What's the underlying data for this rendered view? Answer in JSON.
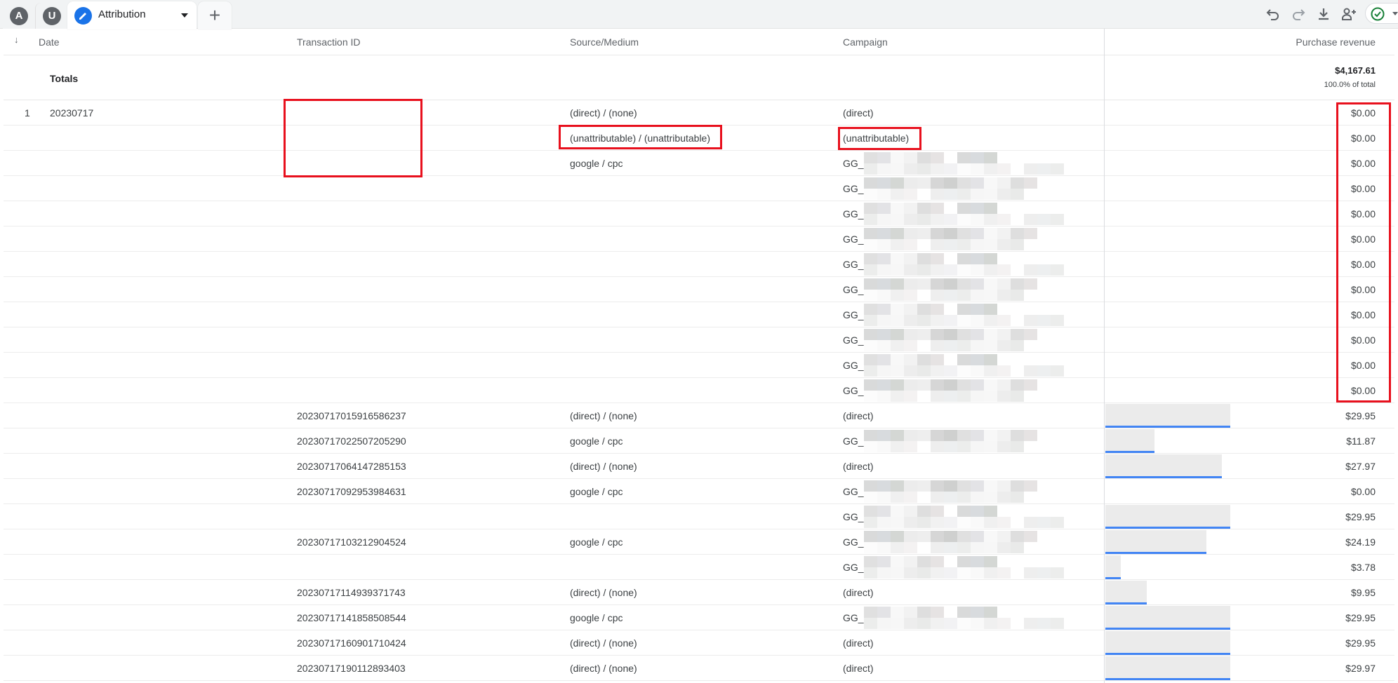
{
  "tabs": {
    "segments": [
      {
        "initial": "A"
      },
      {
        "initial": "U"
      }
    ],
    "active": {
      "label": "Attribution",
      "icon": "pencil-icon"
    },
    "add_label": "+"
  },
  "toolbar": {
    "icons": [
      "undo-icon",
      "redo-icon",
      "download-icon",
      "share-users-icon",
      "status-check-icon"
    ]
  },
  "table": {
    "sort_indicator": "↓",
    "columns": [
      "Date",
      "Transaction ID",
      "Source/Medium",
      "Campaign",
      "Purchase revenue"
    ],
    "totals": {
      "label": "Totals",
      "value": "$4,167.61",
      "percent": "100.0% of total"
    },
    "rows": [
      {
        "num": "1",
        "date": "20230717",
        "tx": "",
        "src": "(direct) / (none)",
        "camp": "(direct)",
        "rev": "$0.00",
        "bar": 0
      },
      {
        "num": "",
        "date": "",
        "tx": "",
        "src": "(unattributable) / (unattributable)",
        "camp": "(unattributable)",
        "rev": "$0.00",
        "bar": 0
      },
      {
        "num": "",
        "date": "",
        "tx": "",
        "src": "google / cpc",
        "camp": "GG_",
        "rev": "$0.00",
        "bar": 0,
        "redacted": true
      },
      {
        "num": "",
        "date": "",
        "tx": "",
        "src": "",
        "camp": "GG_",
        "rev": "$0.00",
        "bar": 0,
        "redacted": true
      },
      {
        "num": "",
        "date": "",
        "tx": "",
        "src": "",
        "camp": "GG_",
        "rev": "$0.00",
        "bar": 0,
        "redacted": true
      },
      {
        "num": "",
        "date": "",
        "tx": "",
        "src": "",
        "camp": "GG_",
        "rev": "$0.00",
        "bar": 0,
        "redacted": true
      },
      {
        "num": "",
        "date": "",
        "tx": "",
        "src": "",
        "camp": "GG_",
        "rev": "$0.00",
        "bar": 0,
        "redacted": true
      },
      {
        "num": "",
        "date": "",
        "tx": "",
        "src": "",
        "camp": "GG_",
        "rev": "$0.00",
        "bar": 0,
        "redacted": true
      },
      {
        "num": "",
        "date": "",
        "tx": "",
        "src": "",
        "camp": "GG_",
        "rev": "$0.00",
        "bar": 0,
        "redacted": true
      },
      {
        "num": "",
        "date": "",
        "tx": "",
        "src": "",
        "camp": "GG_",
        "rev": "$0.00",
        "bar": 0,
        "redacted": true
      },
      {
        "num": "",
        "date": "",
        "tx": "",
        "src": "",
        "camp": "GG_",
        "rev": "$0.00",
        "bar": 0,
        "redacted": true
      },
      {
        "num": "",
        "date": "",
        "tx": "",
        "src": "",
        "camp": "GG_",
        "rev": "$0.00",
        "bar": 0,
        "redacted": true
      },
      {
        "num": "",
        "date": "",
        "tx": "20230717015916586237",
        "src": "(direct) / (none)",
        "camp": "(direct)",
        "rev": "$29.95",
        "bar": 29.95
      },
      {
        "num": "",
        "date": "",
        "tx": "20230717022507205290",
        "src": "google / cpc",
        "camp": "GG_",
        "rev": "$11.87",
        "bar": 11.87,
        "redacted": true
      },
      {
        "num": "",
        "date": "",
        "tx": "20230717064147285153",
        "src": "(direct) / (none)",
        "camp": "(direct)",
        "rev": "$27.97",
        "bar": 27.97
      },
      {
        "num": "",
        "date": "",
        "tx": "20230717092953984631",
        "src": "google / cpc",
        "camp": "GG_",
        "rev": "$0.00",
        "bar": 0,
        "redacted": true
      },
      {
        "num": "",
        "date": "",
        "tx": "",
        "src": "",
        "camp": "GG_",
        "rev": "$29.95",
        "bar": 29.95,
        "redacted": true
      },
      {
        "num": "",
        "date": "",
        "tx": "20230717103212904524",
        "src": "google / cpc",
        "camp": "GG_",
        "rev": "$24.19",
        "bar": 24.19,
        "redacted": true
      },
      {
        "num": "",
        "date": "",
        "tx": "",
        "src": "",
        "camp": "GG_",
        "rev": "$3.78",
        "bar": 3.78,
        "redacted": true
      },
      {
        "num": "",
        "date": "",
        "tx": "20230717114939371743",
        "src": "(direct) / (none)",
        "camp": "(direct)",
        "rev": "$9.95",
        "bar": 9.95
      },
      {
        "num": "",
        "date": "",
        "tx": "20230717141858508544",
        "src": "google / cpc",
        "camp": "GG_",
        "rev": "$29.95",
        "bar": 29.95,
        "redacted": true
      },
      {
        "num": "",
        "date": "",
        "tx": "20230717160901710424",
        "src": "(direct) / (none)",
        "camp": "(direct)",
        "rev": "$29.95",
        "bar": 29.95
      },
      {
        "num": "",
        "date": "",
        "tx": "20230717190112893403",
        "src": "(direct) / (none)",
        "camp": "(direct)",
        "rev": "$29.97",
        "bar": 29.97
      }
    ],
    "bar_max": 29.97
  },
  "colors": {
    "accent": "#1a73e8",
    "bar_line": "#4285f4",
    "bar_fill": "#ebebeb",
    "highlight": "#e8101d",
    "status_check": "#188038"
  }
}
